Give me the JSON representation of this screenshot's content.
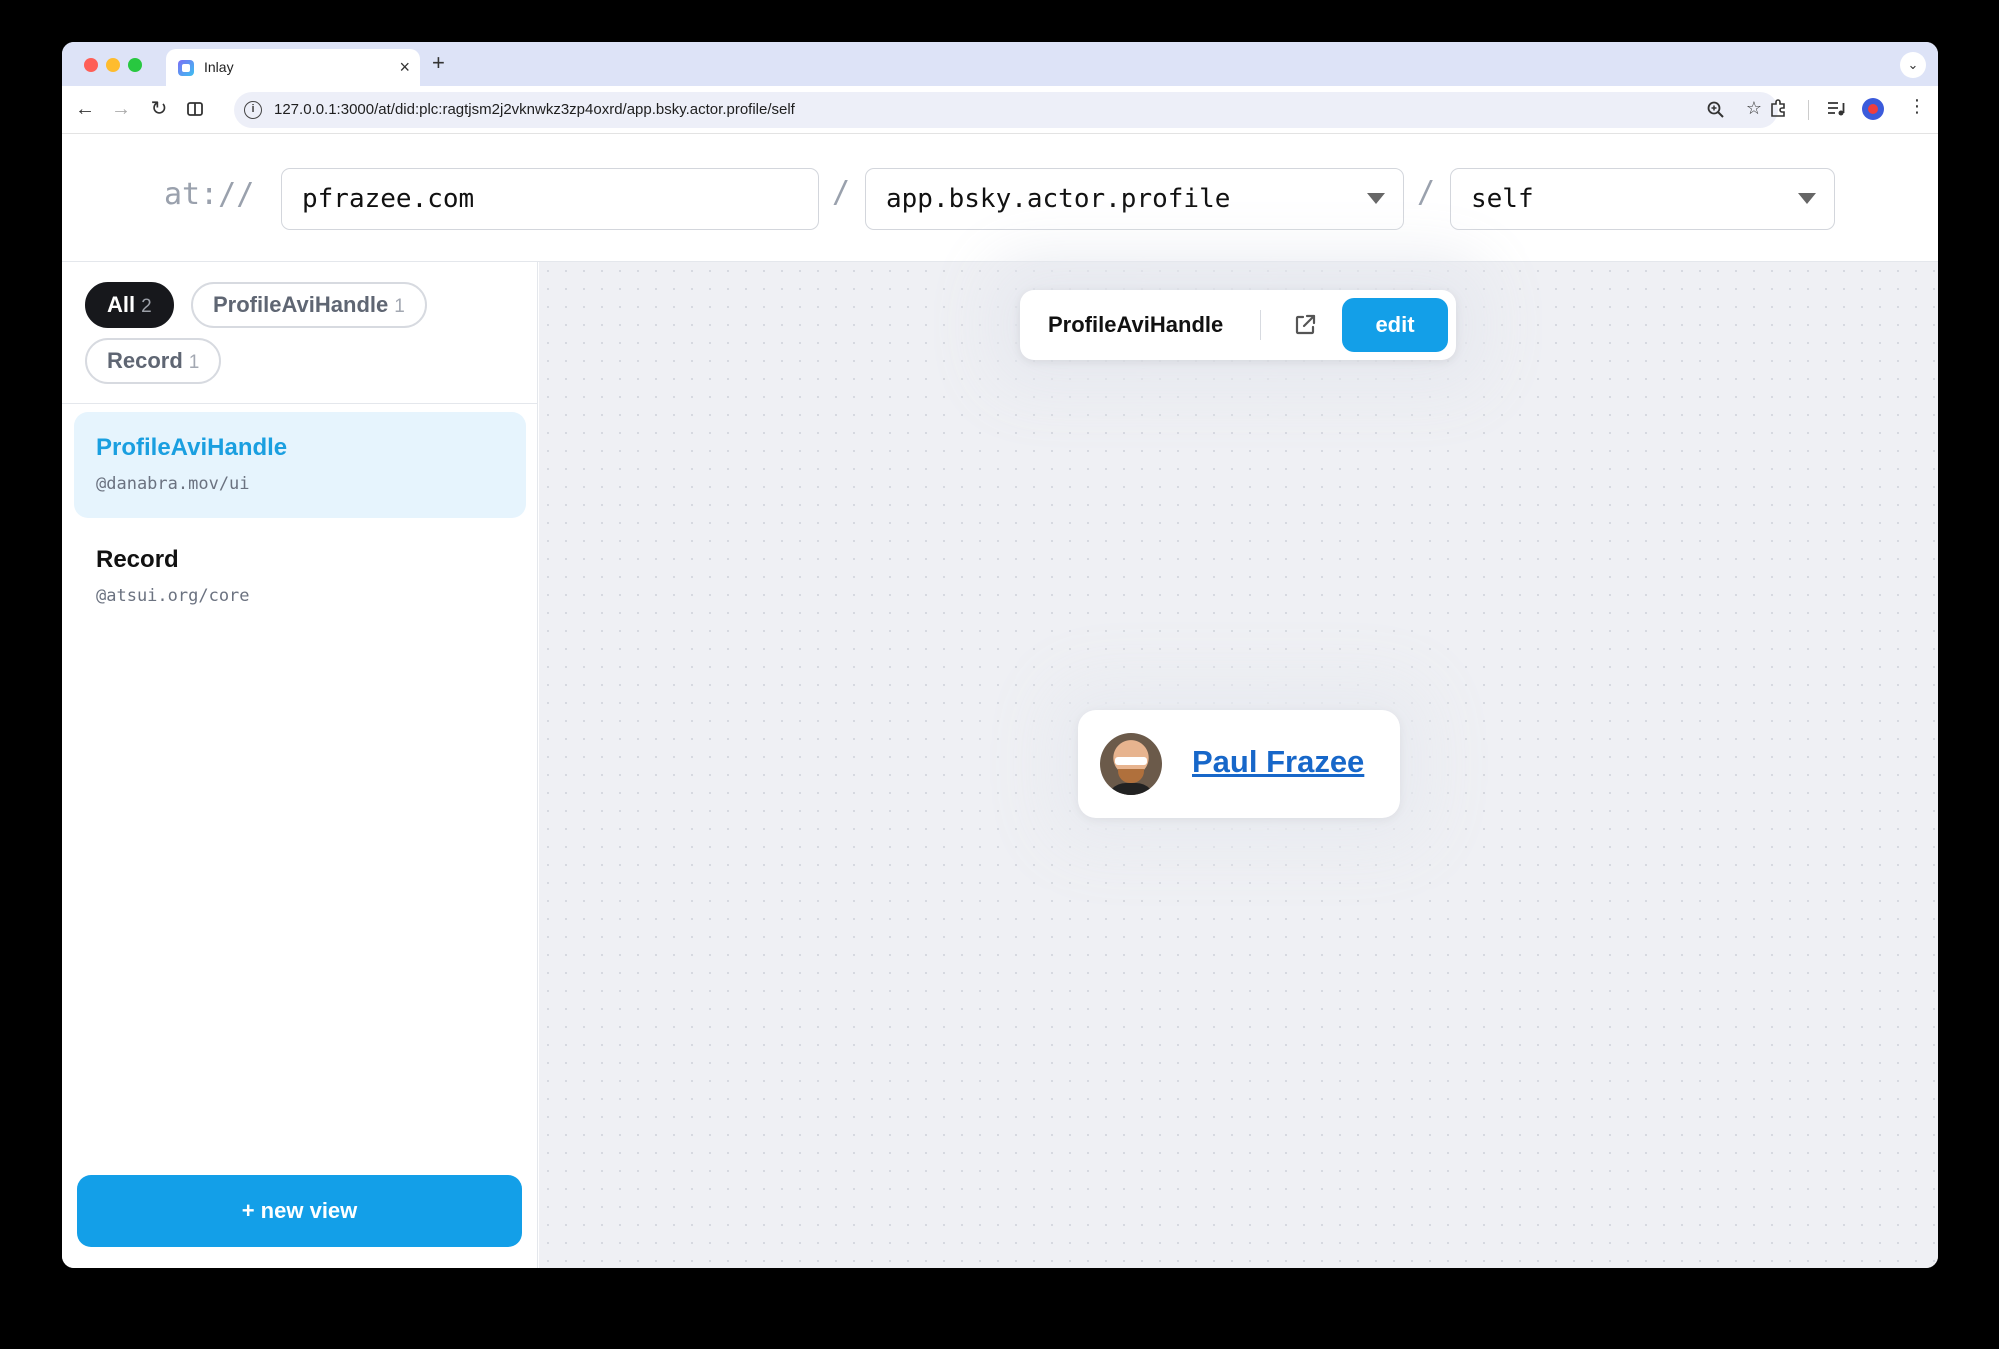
{
  "browser": {
    "tab_title": "Inlay",
    "tab_close": "×",
    "new_tab": "+",
    "url": "127.0.0.1:3000/at/did:plc:ragtjsm2j2vknwkz3zp4oxrd/app.bsky.actor.profile/self"
  },
  "header": {
    "at_label": "at://",
    "slash": "/",
    "handle_value": "pfrazee.com",
    "collection_value": "app.bsky.actor.profile",
    "rkey_value": "self"
  },
  "filters": [
    {
      "label": "All",
      "count": "2",
      "active": true
    },
    {
      "label": "ProfileAviHandle",
      "count": "1",
      "active": false
    },
    {
      "label": "Record",
      "count": "1",
      "active": false
    }
  ],
  "views": [
    {
      "name": "ProfileAviHandle",
      "source": "@danabra.mov/ui",
      "selected": true
    },
    {
      "name": "Record",
      "source": "@atsui.org/core",
      "selected": false
    }
  ],
  "new_view_label": "+ new view",
  "preview_bar": {
    "title": "ProfileAviHandle",
    "edit_label": "edit"
  },
  "profile_card": {
    "display_name": "Paul Frazee"
  },
  "colors": {
    "accent": "#139fe8",
    "link": "#1767c9",
    "selected_bg": "#e6f4fd"
  },
  "icons": {
    "back": "arrow-left-icon",
    "forward": "arrow-right-icon",
    "reload": "reload-icon",
    "split": "split-view-icon",
    "info": "info-icon",
    "zoom": "zoom-icon",
    "bookmark": "star-icon",
    "extensions": "puzzle-icon",
    "media": "media-control-icon",
    "menu": "kebab-menu-icon",
    "external": "external-link-icon"
  }
}
